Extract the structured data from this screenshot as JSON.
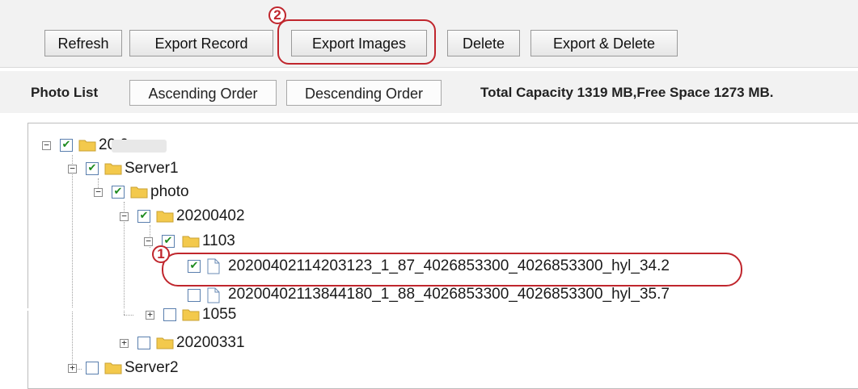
{
  "toolbar": {
    "refresh": "Refresh",
    "export_record": "Export Record",
    "export_images": "Export Images",
    "delete": "Delete",
    "export_delete": "Export & Delete"
  },
  "photo_list": {
    "label": "Photo List",
    "ascending": "Ascending Order",
    "descending": "Descending Order",
    "capacity": "Total Capacity 1319 MB,Free Space 1273 MB."
  },
  "tree": {
    "root": "20        0",
    "server1": "Server1",
    "photo": "photo",
    "date1": "20200402",
    "hour1": "1103",
    "file1": "20200402114203123_1_87_4026853300_4026853300_hyl_34.2",
    "file2": "20200402113844180_1_88_4026853300_4026853300_hyl_35.7",
    "hour2": "1055",
    "date2": "20200331",
    "server2": "Server2"
  },
  "annotations": {
    "one": "1",
    "two": "2"
  },
  "colors": {
    "callout": "#c0262d",
    "check": "#1c8a1c",
    "folder": "#f3c94c"
  }
}
